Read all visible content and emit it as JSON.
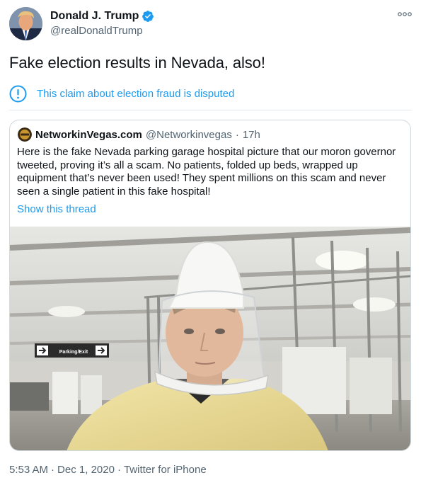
{
  "author": {
    "name": "Donald J. Trump",
    "handle": "@realDonaldTrump",
    "verified": true,
    "avatar_icon": "profile-photo"
  },
  "tweet": {
    "text": "Fake election results in Nevada, also!"
  },
  "disputed_notice": {
    "icon": "exclamation-circle-icon",
    "text": "This claim about election fraud is disputed"
  },
  "quoted_tweet": {
    "name": "NetworkinVegas.com",
    "handle": "@Networkinvegas",
    "separator": "·",
    "time": "17h",
    "text": "Here is the fake Nevada parking garage hospital picture that our moron governor tweeted, proving it’s all a scam. No patients, folded up beds, wrapped up equipment that’s never been used! They spent millions on this scam and never seen a single patient in this fake hospital!",
    "show_thread": "Show this thread",
    "media": {
      "sign_text": "Parking/Exit"
    }
  },
  "meta": {
    "time": "5:53 AM",
    "sep1": "·",
    "date": "Dec 1, 2020",
    "sep2": "·",
    "source": "Twitter for iPhone"
  },
  "colors": {
    "link": "#1d9bf0",
    "secondary_text": "#536471",
    "border": "#cfd9de"
  }
}
